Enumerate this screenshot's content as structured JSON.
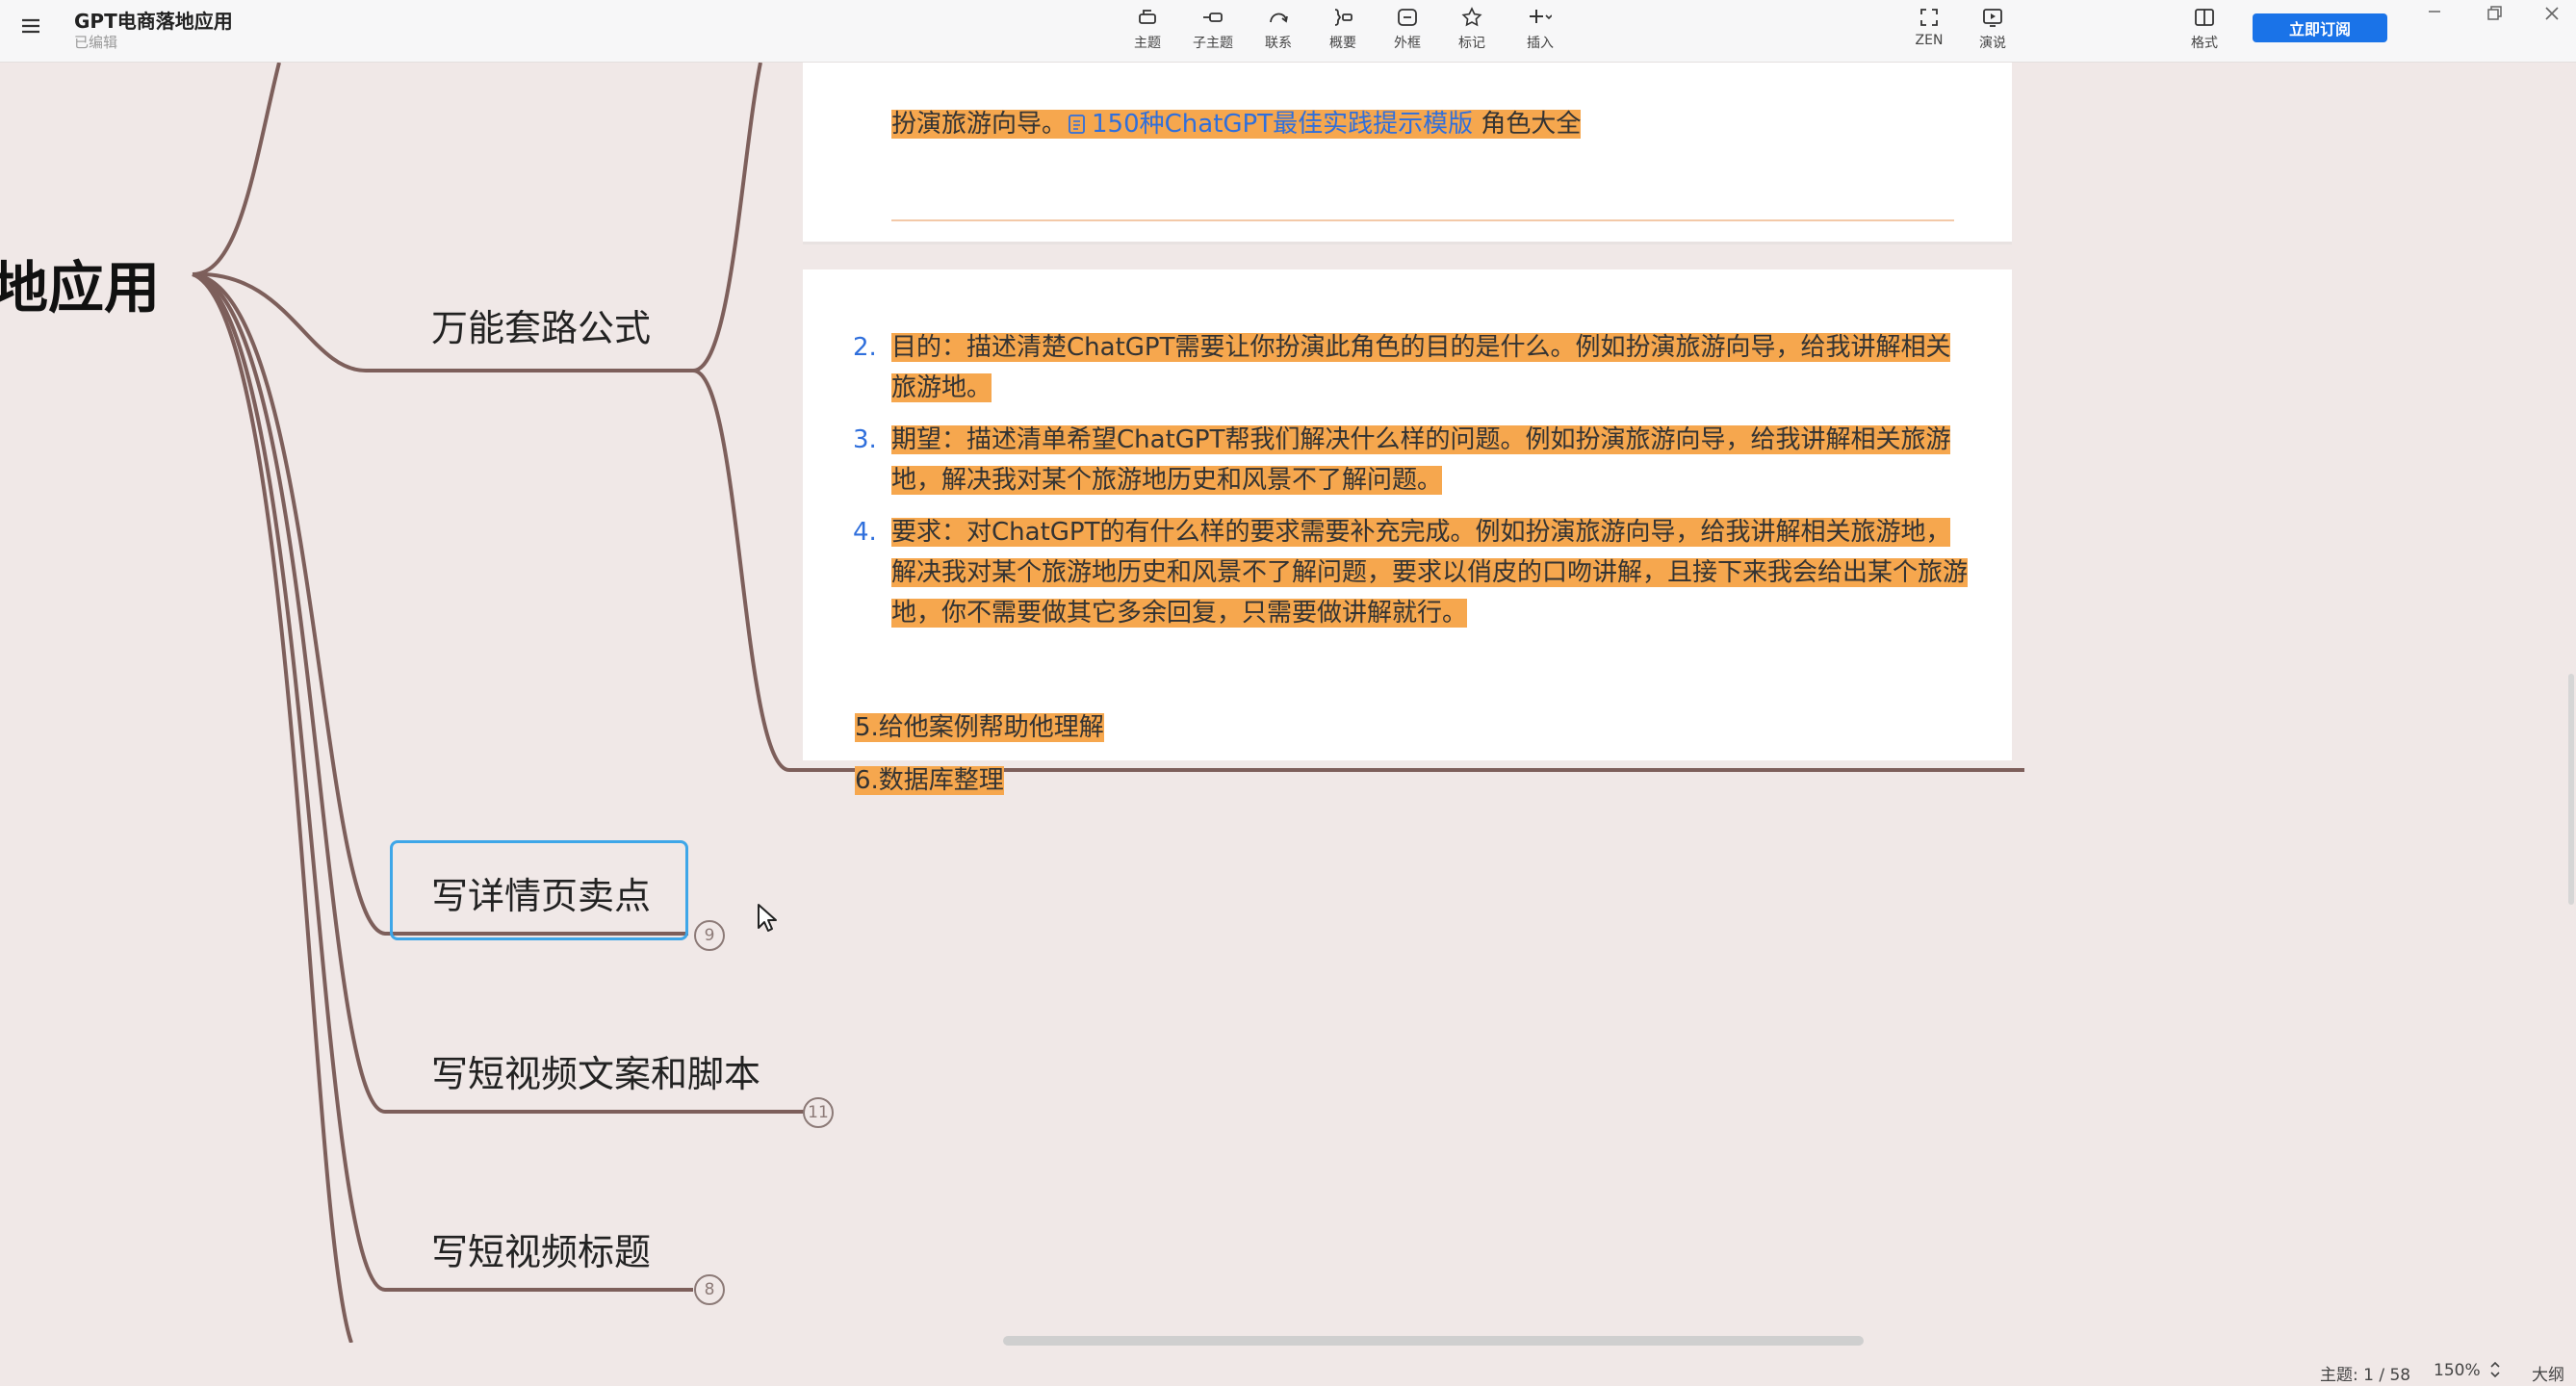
{
  "app": {
    "title": "GPT电商落地应用",
    "status": "已编辑"
  },
  "toolbar": {
    "tools": [
      {
        "id": "topic",
        "label": "主题",
        "icon": "topic-icon"
      },
      {
        "id": "subtopic",
        "label": "子主题",
        "icon": "subtopic-icon"
      },
      {
        "id": "relation",
        "label": "联系",
        "icon": "relation-icon"
      },
      {
        "id": "summary",
        "label": "概要",
        "icon": "summary-icon"
      },
      {
        "id": "boundary",
        "label": "外框",
        "icon": "boundary-icon"
      },
      {
        "id": "marker",
        "label": "标记",
        "icon": "star-icon"
      },
      {
        "id": "insert",
        "label": "插入",
        "icon": "plus-icon"
      }
    ],
    "zen_label": "ZEN",
    "present_label": "演说",
    "format_label": "格式",
    "subscribe_label": "立即订阅"
  },
  "mindmap": {
    "root_label": "地应用",
    "branches": [
      {
        "label": "万能套路公式"
      },
      {
        "label": "写详情页卖点",
        "count": "9",
        "selected": true
      },
      {
        "label": "写短视频文案和脚本",
        "count": "11"
      },
      {
        "label": "写短视频标题",
        "count": "8"
      }
    ],
    "line_color": "#7d5f5b"
  },
  "notes": {
    "top_card": {
      "line_prefix": "扮演旅游向导。",
      "link_text": "150种ChatGPT最佳实践提示模版",
      "line_suffix": " 角色大全"
    },
    "main_card": {
      "items": [
        {
          "num": "2.",
          "text": "目的：描述清楚ChatGPT需要让你扮演此角色的目的是什么。例如扮演旅游向导，给我讲解相关旅游地。"
        },
        {
          "num": "3.",
          "text": "期望：描述清单希望ChatGPT帮我们解决什么样的问题。例如扮演旅游向导，给我讲解相关旅游地，解决我对某个旅游地历史和风景不了解问题。"
        },
        {
          "num": "4.",
          "text": "要求：对ChatGPT的有什么样的要求需要补充完成。例如扮演旅游向导，给我讲解相关旅游地，解决我对某个旅游地历史和风景不了解问题，要求以俏皮的口吻讲解，且接下来我会给出某个旅游地，你不需要做其它多余回复，只需要做讲解就行。"
        }
      ],
      "line5": "5.给他案例帮助他理解",
      "line6": "6.数据库整理"
    },
    "highlight_color": "#f6a74e"
  },
  "statusbar": {
    "topic_count": "主题: 1 / 58",
    "zoom": "150%",
    "outline_label": "大纲"
  }
}
